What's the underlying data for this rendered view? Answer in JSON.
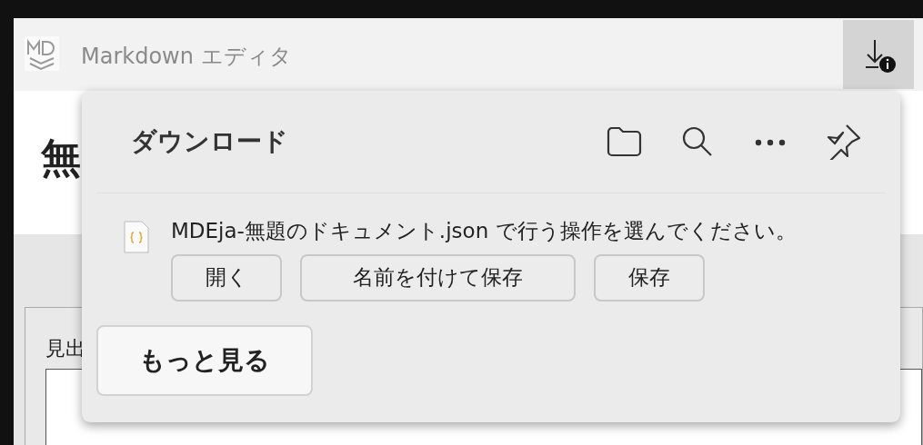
{
  "app_bar": {
    "title": "Markdown エディタ"
  },
  "background_page": {
    "title": "無",
    "field_label": "見出"
  },
  "downloads_panel": {
    "title": "ダウンロード",
    "message": "MDEja-無題のドキュメント.json で行う操作を選んでください。",
    "actions": [
      "開く",
      "名前を付けて保存",
      "保存"
    ],
    "more_button": "もっと見る"
  }
}
